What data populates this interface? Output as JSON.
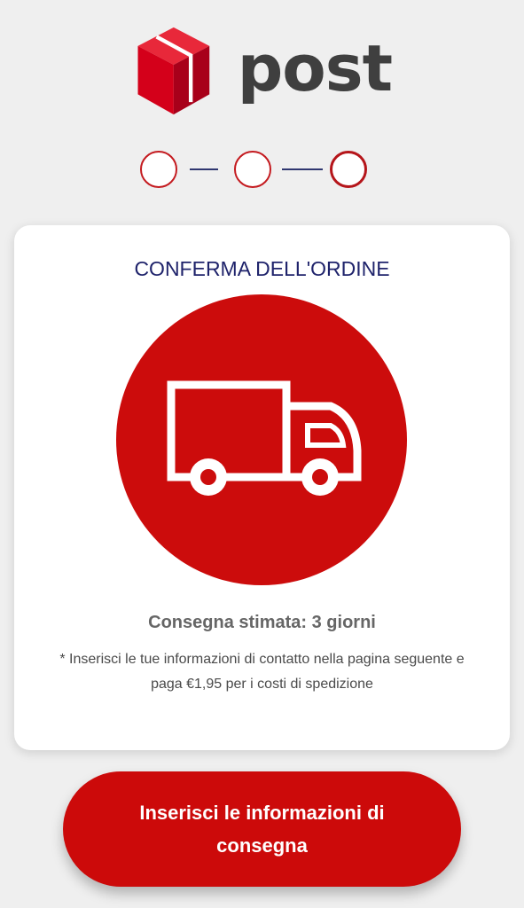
{
  "brand": {
    "logo_text": "post",
    "icon": "dpd-cube-icon"
  },
  "stepper": {
    "steps": 3,
    "current_step": 3
  },
  "card": {
    "title": "CONFERMA DELL'ORDINE",
    "icon": "delivery-truck-icon",
    "eta": "Consegna stimata: 3 giorni",
    "note": "* Inserisci le tue informazioni di contatto nella pagina seguente e paga €1,95 per i costi di spedizione"
  },
  "cta": {
    "label": "Inserisci le informazioni di consegna"
  },
  "colors": {
    "brand_red": "#cc0c0c",
    "title_navy": "#1f236b",
    "logo_grey": "#3f3f3f",
    "background": "#efefef"
  }
}
